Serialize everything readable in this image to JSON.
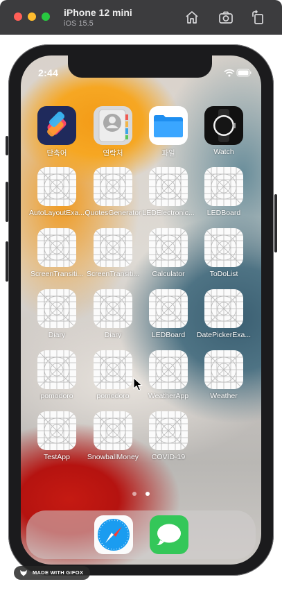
{
  "simulator": {
    "device_name": "iPhone 12 mini",
    "os_version": "iOS 15.5",
    "toolbar": [
      {
        "icon": "home-icon"
      },
      {
        "icon": "screenshot-camera-icon"
      },
      {
        "icon": "rotate-icon"
      }
    ]
  },
  "status_bar": {
    "time": "2:44",
    "icons": [
      "wifi-icon",
      "battery-icon"
    ]
  },
  "home_screen": {
    "apps": [
      {
        "label": "단축어",
        "icon": "shortcuts-icon"
      },
      {
        "label": "연락처",
        "icon": "contacts-icon"
      },
      {
        "label": "파일",
        "icon": "files-icon"
      },
      {
        "label": "Watch",
        "icon": "watch-icon"
      },
      {
        "label": "AutoLayoutExa...",
        "icon": "placeholder-app-icon"
      },
      {
        "label": "QuotesGenerator",
        "icon": "placeholder-app-icon"
      },
      {
        "label": "LEDElectronic...",
        "icon": "placeholder-app-icon"
      },
      {
        "label": "LEDBoard",
        "icon": "placeholder-app-icon"
      },
      {
        "label": "ScreenTransiti...",
        "icon": "placeholder-app-icon"
      },
      {
        "label": "ScreenTransiti...",
        "icon": "placeholder-app-icon"
      },
      {
        "label": "Calculator",
        "icon": "placeholder-app-icon"
      },
      {
        "label": "ToDoList",
        "icon": "placeholder-app-icon"
      },
      {
        "label": "Diary",
        "icon": "placeholder-app-icon"
      },
      {
        "label": "Diary",
        "icon": "placeholder-app-icon"
      },
      {
        "label": "LEDBoard",
        "icon": "placeholder-app-icon"
      },
      {
        "label": "DatePickerExa...",
        "icon": "placeholder-app-icon"
      },
      {
        "label": "pomodoro",
        "icon": "placeholder-app-icon"
      },
      {
        "label": "pomodoro",
        "icon": "placeholder-app-icon"
      },
      {
        "label": "WeatherApp",
        "icon": "placeholder-app-icon"
      },
      {
        "label": "Weather",
        "icon": "placeholder-app-icon"
      },
      {
        "label": "TestApp",
        "icon": "placeholder-app-icon"
      },
      {
        "label": "SnowballMoney",
        "icon": "placeholder-app-icon"
      },
      {
        "label": "COVID-19",
        "icon": "placeholder-app-icon"
      }
    ],
    "page_indicator": {
      "pages": 2,
      "current": 2
    },
    "dock": [
      {
        "icon": "safari-icon"
      },
      {
        "icon": "messages-icon"
      }
    ]
  },
  "watermark": {
    "text": "MADE WITH GIFOX"
  },
  "colors": {
    "titlebar": "#3c3c3e",
    "close": "#ff5f57",
    "minimize": "#febc2e",
    "zoom": "#28c840"
  }
}
